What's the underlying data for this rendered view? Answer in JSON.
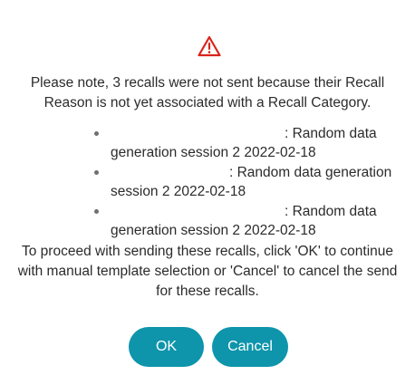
{
  "dialog": {
    "icon": "warning-triangle-icon",
    "message": "Please note, 3 recalls were not sent because their Recall Reason is not yet associated with a Recall Category.",
    "items": [
      {
        "redacted_prefix": "",
        "line1_suffix": ": Random data",
        "line2": "generation session 2 2022-02-18"
      },
      {
        "redacted_prefix": "",
        "line1_suffix": ": Random data generation",
        "line2": "session 2 2022-02-18"
      },
      {
        "redacted_prefix": "",
        "line1_suffix": ": Random data",
        "line2": "generation session 2 2022-02-18"
      }
    ],
    "proceed_text": "To proceed with sending these recalls, click 'OK' to continue with manual template selection or 'Cancel' to cancel the send for these recalls.",
    "ok_label": "OK",
    "cancel_label": "Cancel"
  },
  "colors": {
    "button_bg": "#0e95ab",
    "button_text": "#ffffff",
    "warning": "#d9241c",
    "text": "#2b2b2b"
  }
}
